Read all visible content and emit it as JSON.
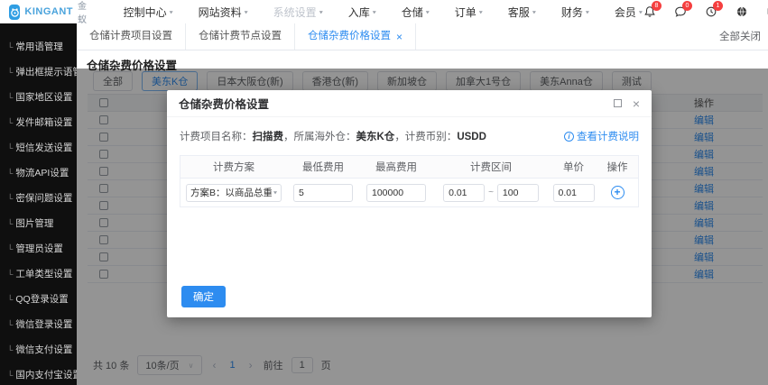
{
  "colors": {
    "accent": "#2d8cf0",
    "badge": "#f53f3f",
    "sidebar_bg": "#0f0f0f",
    "brand_blue": "#2f9ee3"
  },
  "navbar": {
    "brand_name": "KINGANT",
    "brand_suffix": "金蚁",
    "menus": [
      {
        "label": "控制中心"
      },
      {
        "label": "网站资料"
      },
      {
        "label": "系统设置",
        "muted": true
      },
      {
        "label": "入库"
      },
      {
        "label": "仓储"
      },
      {
        "label": "订单"
      },
      {
        "label": "客服"
      },
      {
        "label": "财务"
      },
      {
        "label": "会员"
      }
    ],
    "badges": {
      "bell": "8",
      "chat": "0",
      "history": "1"
    },
    "username": "iadm"
  },
  "sidebar": {
    "items": [
      "常用语管理",
      "弹出框提示语管理",
      "国家地区设置",
      "发件邮箱设置",
      "短信发送设置",
      "物流API设置",
      "密保问题设置",
      "图片管理",
      "管理员设置",
      "工单类型设置",
      "QQ登录设置",
      "微信登录设置",
      "微信支付设置",
      "国内支付宝设置"
    ]
  },
  "tabbar": {
    "tabs": [
      {
        "label": "仓储计费项目设置"
      },
      {
        "label": "仓储计费节点设置"
      },
      {
        "label": "仓储杂费价格设置",
        "active": true,
        "closable": true
      }
    ],
    "close_all": "全部关闭"
  },
  "page": {
    "title": "仓储杂费价格设置",
    "filters": [
      {
        "label": "全部"
      },
      {
        "label": "美东K仓",
        "active": true
      },
      {
        "label": "日本大阪仓(新)"
      },
      {
        "label": "香港仓(新)"
      },
      {
        "label": "新加坡仓"
      },
      {
        "label": "加拿大1号仓"
      },
      {
        "label": "美东Anna仓"
      },
      {
        "label": "测试"
      }
    ],
    "table": {
      "op_header": "操作",
      "edit_label": "编辑",
      "row_count": 10
    },
    "pagination": {
      "total": "共 10 条",
      "page_size": "10条/页",
      "prev": "‹",
      "page": "1",
      "next": "›",
      "goto_label": "前往",
      "goto_value": "1",
      "goto_suffix": "页"
    }
  },
  "modal": {
    "title": "仓储杂费价格设置",
    "info_segments": [
      {
        "text": "计费项目名称："
      },
      {
        "text": "扫描费",
        "bold": true
      },
      {
        "text": "，所属海外仓："
      },
      {
        "text": "美东K仓",
        "bold": true
      },
      {
        "text": "，计费币别："
      },
      {
        "text": "USDD",
        "bold": true
      }
    ],
    "help_link": "查看计费说明",
    "table": {
      "headers": [
        "计费方案",
        "最低费用",
        "最高费用",
        "计费区间",
        "单价",
        "操作"
      ],
      "row": {
        "plan": "方案B：以商品总重",
        "min": "5",
        "max": "100000",
        "range_from": "0.01",
        "range_sep": "~",
        "range_to": "100",
        "unit": "0.01"
      }
    },
    "confirm_label": "确定"
  }
}
